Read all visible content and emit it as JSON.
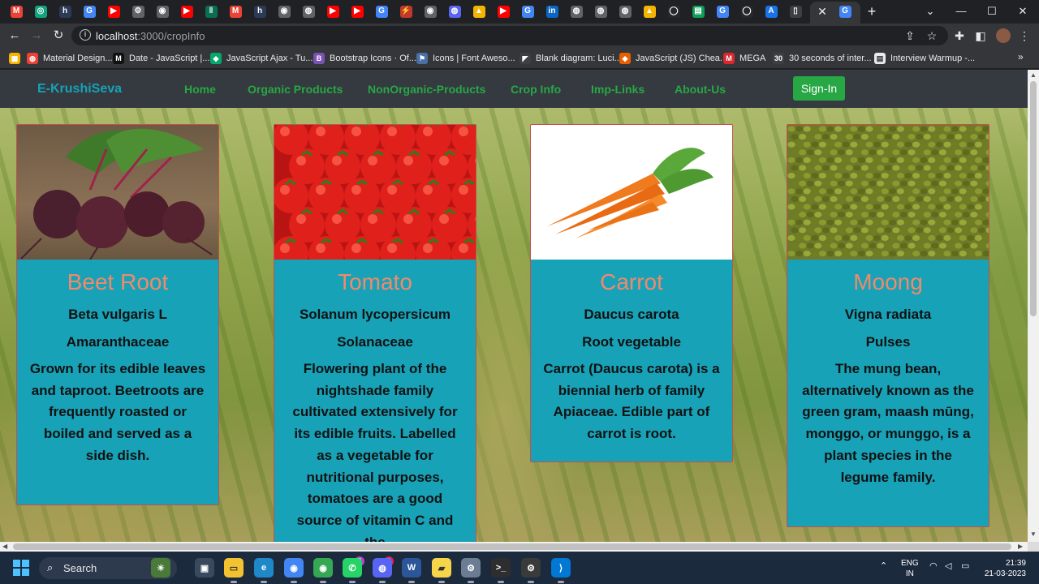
{
  "browser": {
    "url_host": "localhost",
    "url_path": ":3000/cropInfo",
    "tab_close": "✕",
    "new_tab": "+",
    "tab_favicons": [
      {
        "icon": "gmail-icon",
        "color": "#ea4335",
        "glyph": "M"
      },
      {
        "icon": "chatgpt-icon",
        "color": "#10a37f",
        "glyph": "◎"
      },
      {
        "icon": "hackerrank-icon",
        "color": "#2b3a55",
        "glyph": "h"
      },
      {
        "icon": "google-icon",
        "color": "#4285f4",
        "glyph": "G"
      },
      {
        "icon": "youtube-icon",
        "color": "#ff0000",
        "glyph": "▶"
      },
      {
        "icon": "settings-icon",
        "color": "#5f6368",
        "glyph": "⚙"
      },
      {
        "icon": "chrome-icon",
        "color": "#5f6368",
        "glyph": "◉"
      },
      {
        "icon": "youtube-icon",
        "color": "#ff0000",
        "glyph": "▶"
      },
      {
        "icon": "web-icon",
        "color": "#0b6e4f",
        "glyph": "‖"
      },
      {
        "icon": "gmail-icon",
        "color": "#ea4335",
        "glyph": "M"
      },
      {
        "icon": "hackerrank-icon",
        "color": "#2b3a55",
        "glyph": "h"
      },
      {
        "icon": "chrome-icon",
        "color": "#5f6368",
        "glyph": "◉"
      },
      {
        "icon": "globe-icon",
        "color": "#5f6368",
        "glyph": "◍"
      },
      {
        "icon": "youtube-icon",
        "color": "#ff0000",
        "glyph": "▶"
      },
      {
        "icon": "youtube-icon",
        "color": "#ff0000",
        "glyph": "▶"
      },
      {
        "icon": "google-icon",
        "color": "#4285f4",
        "glyph": "G"
      },
      {
        "icon": "bolt-icon",
        "color": "#c0392b",
        "glyph": "⚡"
      },
      {
        "icon": "chrome-icon",
        "color": "#5f6368",
        "glyph": "◉"
      },
      {
        "icon": "messenger-icon",
        "color": "#5865f2",
        "glyph": "◍"
      },
      {
        "icon": "drive-icon",
        "color": "#f4b400",
        "glyph": "▲"
      },
      {
        "icon": "youtube-icon",
        "color": "#ff0000",
        "glyph": "▶"
      },
      {
        "icon": "google-icon",
        "color": "#4285f4",
        "glyph": "G"
      },
      {
        "icon": "linkedin-icon",
        "color": "#0a66c2",
        "glyph": "in"
      },
      {
        "icon": "globe-icon",
        "color": "#5f6368",
        "glyph": "◍"
      },
      {
        "icon": "globe-icon",
        "color": "#5f6368",
        "glyph": "◍"
      },
      {
        "icon": "globe-icon",
        "color": "#5f6368",
        "glyph": "◍"
      },
      {
        "icon": "drive-icon",
        "color": "#f4b400",
        "glyph": "▲"
      },
      {
        "icon": "github-icon",
        "color": "#24292e",
        "glyph": "◯"
      },
      {
        "icon": "sheets-icon",
        "color": "#0f9d58",
        "glyph": "▤"
      },
      {
        "icon": "google-icon",
        "color": "#4285f4",
        "glyph": "G"
      },
      {
        "icon": "github-icon",
        "color": "#24292e",
        "glyph": "◯"
      },
      {
        "icon": "app-icon",
        "color": "#1a73e8",
        "glyph": "A"
      },
      {
        "icon": "doc-icon",
        "color": "#3c4043",
        "glyph": "▯"
      }
    ],
    "active_tab_icon": {
      "icon": "google-icon",
      "color": "#4285f4",
      "glyph": "G"
    },
    "bookmarks": [
      {
        "label": "",
        "icon": "apps-grid-icon",
        "color": "#f4b400",
        "glyph": "▦"
      },
      {
        "label": "Material Design...",
        "icon": "material-icon",
        "color": "#ea4335",
        "glyph": "◍"
      },
      {
        "label": "Date - JavaScript |...",
        "icon": "mdn-icon",
        "color": "#111111",
        "glyph": "M"
      },
      {
        "label": "JavaScript Ajax - Tu...",
        "icon": "w3-icon",
        "color": "#04aa6d",
        "glyph": "◆"
      },
      {
        "label": "Bootstrap Icons · Of...",
        "icon": "bootstrap-icon",
        "color": "#7952b3",
        "glyph": "B"
      },
      {
        "label": "Icons | Font Aweso...",
        "icon": "flag-icon",
        "color": "#4a6fa5",
        "glyph": "⚑"
      },
      {
        "label": "Blank diagram: Luci...",
        "icon": "lucid-icon",
        "color": "#3c4043",
        "glyph": "◤"
      },
      {
        "label": "JavaScript (JS) Chea...",
        "icon": "cheatsheet-icon",
        "color": "#e66000",
        "glyph": "◆"
      },
      {
        "label": "MEGA",
        "icon": "mega-icon",
        "color": "#d9272e",
        "glyph": "M"
      },
      {
        "label": "30 seconds of inter...",
        "icon": "thirty-icon",
        "color": "#3c4043",
        "glyph": "30"
      },
      {
        "label": "Interview Warmup -...",
        "icon": "page-icon",
        "color": "#e8eaed",
        "glyph": "▤"
      }
    ]
  },
  "site": {
    "brand": "E-KrushiSeva",
    "nav": [
      "Home",
      "Organic Products",
      "NonOrganic-Products",
      "Crop Info",
      "Imp-Links",
      "About-Us"
    ],
    "signin": "Sign-In"
  },
  "crops": [
    {
      "name": "Beet Root",
      "scientific": "Beta vulgaris L",
      "family": "Amaranthaceae",
      "description": "Grown for its edible leaves and taproot. Beetroots are frequently roasted or boiled and served as a side dish.",
      "image": "beetroot"
    },
    {
      "name": "Tomato",
      "scientific": "Solanum lycopersicum",
      "family": "Solanaceae",
      "description": "Flowering plant of the nightshade family cultivated extensively for its edible fruits. Labelled as a vegetable for nutritional purposes, tomatoes are a good source of vitamin C and the",
      "image": "tomato"
    },
    {
      "name": "Carrot",
      "scientific": "Daucus carota",
      "family": "Root vegetable",
      "description": "Carrot (Daucus carota) is a biennial herb of family Apiaceae. Edible part of carrot is root.",
      "image": "carrot"
    },
    {
      "name": "Moong",
      "scientific": "Vigna radiata",
      "family": "Pulses",
      "description": "The mung bean, alternatively known as the green gram, maash mūng, monggo, or munggo, is a plant species in the legume family.",
      "image": "moong"
    }
  ],
  "taskbar": {
    "search": "Search",
    "apps": [
      {
        "icon": "widgets-icon",
        "color": "#4a7a3a",
        "glyph": "☀"
      },
      {
        "icon": "task-view-icon",
        "color": "#3a4a5e",
        "glyph": "▣"
      },
      {
        "icon": "file-explorer-icon",
        "color": "#f2c230",
        "glyph": "▭"
      },
      {
        "icon": "edge-icon",
        "color": "#1e88c8",
        "glyph": "e"
      },
      {
        "icon": "chrome-icon",
        "color": "#4285f4",
        "glyph": "◉"
      },
      {
        "icon": "chrome-icon",
        "color": "#34a853",
        "glyph": "◉"
      },
      {
        "icon": "whatsapp-icon",
        "color": "#25d366",
        "glyph": "✆"
      },
      {
        "icon": "discord-icon",
        "color": "#5865f2",
        "glyph": "◍"
      },
      {
        "icon": "word-icon",
        "color": "#2b579a",
        "glyph": "W"
      },
      {
        "icon": "sticky-notes-icon",
        "color": "#f7d54a",
        "glyph": "▰"
      },
      {
        "icon": "settings-icon",
        "color": "#6b7c93",
        "glyph": "⚙"
      },
      {
        "icon": "terminal-icon",
        "color": "#2e2e2e",
        "glyph": ">_"
      },
      {
        "icon": "gear-app-icon",
        "color": "#3a3a3a",
        "glyph": "⚙"
      },
      {
        "icon": "vscode-icon",
        "color": "#0078d4",
        "glyph": "⟩"
      }
    ],
    "badges": {
      "whatsapp": "2",
      "discord": "3"
    },
    "lang_top": "ENG",
    "lang_bottom": "IN",
    "time": "21:39",
    "date": "21-03-2023"
  }
}
